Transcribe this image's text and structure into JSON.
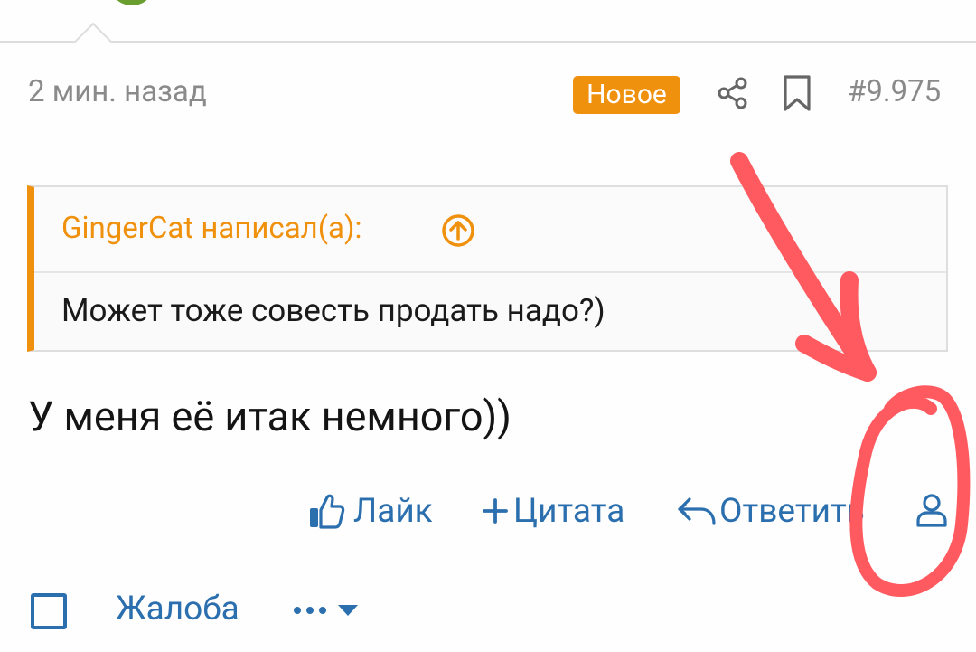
{
  "post": {
    "time": "2 мин. назад",
    "badge": "Новое",
    "number": "#9.975",
    "text": "У меня её итак немного))"
  },
  "quote": {
    "author": "GingerCat написал(а):",
    "text": "Может тоже совесть продать надо?)"
  },
  "actions": {
    "like": "Лайк",
    "quote": "Цитата",
    "reply": "Ответить"
  },
  "footer": {
    "report": "Жалоба"
  },
  "colors": {
    "accent": "#f0910d",
    "link": "#2b6fae",
    "annotation": "#ff5a5f"
  },
  "icons": [
    "share-icon",
    "bookmark-icon",
    "arrow-up-circle-icon",
    "thumbs-up-icon",
    "plus-icon",
    "reply-icon",
    "user-icon",
    "ellipsis-icon",
    "caret-down-icon"
  ]
}
